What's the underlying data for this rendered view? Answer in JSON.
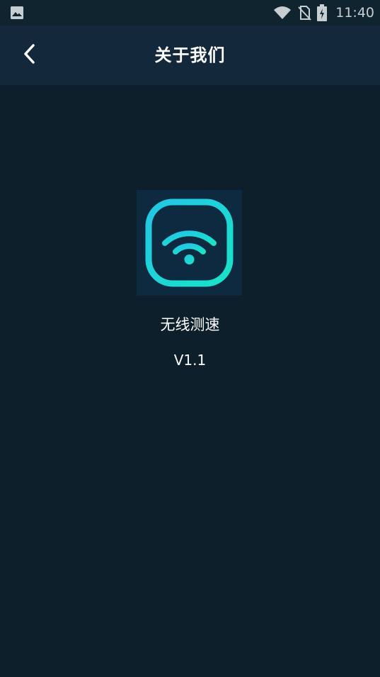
{
  "status_bar": {
    "time": "11:40",
    "left_icon": "image-icon",
    "right_icons": [
      "wifi-icon",
      "no-sim-icon",
      "battery-icon"
    ]
  },
  "app_bar": {
    "back_icon": "chevron-left-icon",
    "title": "关于我们"
  },
  "about": {
    "logo_icon": "wifi-app-icon",
    "app_name": "无线测速",
    "version": "V1.1"
  },
  "colors": {
    "background": "#0c1f2b",
    "app_bar": "#13283a",
    "logo_background": "#0d2a40",
    "logo_gradient_start": "#22c6e6",
    "logo_gradient_end": "#19e3c8",
    "text": "#ffffff"
  }
}
